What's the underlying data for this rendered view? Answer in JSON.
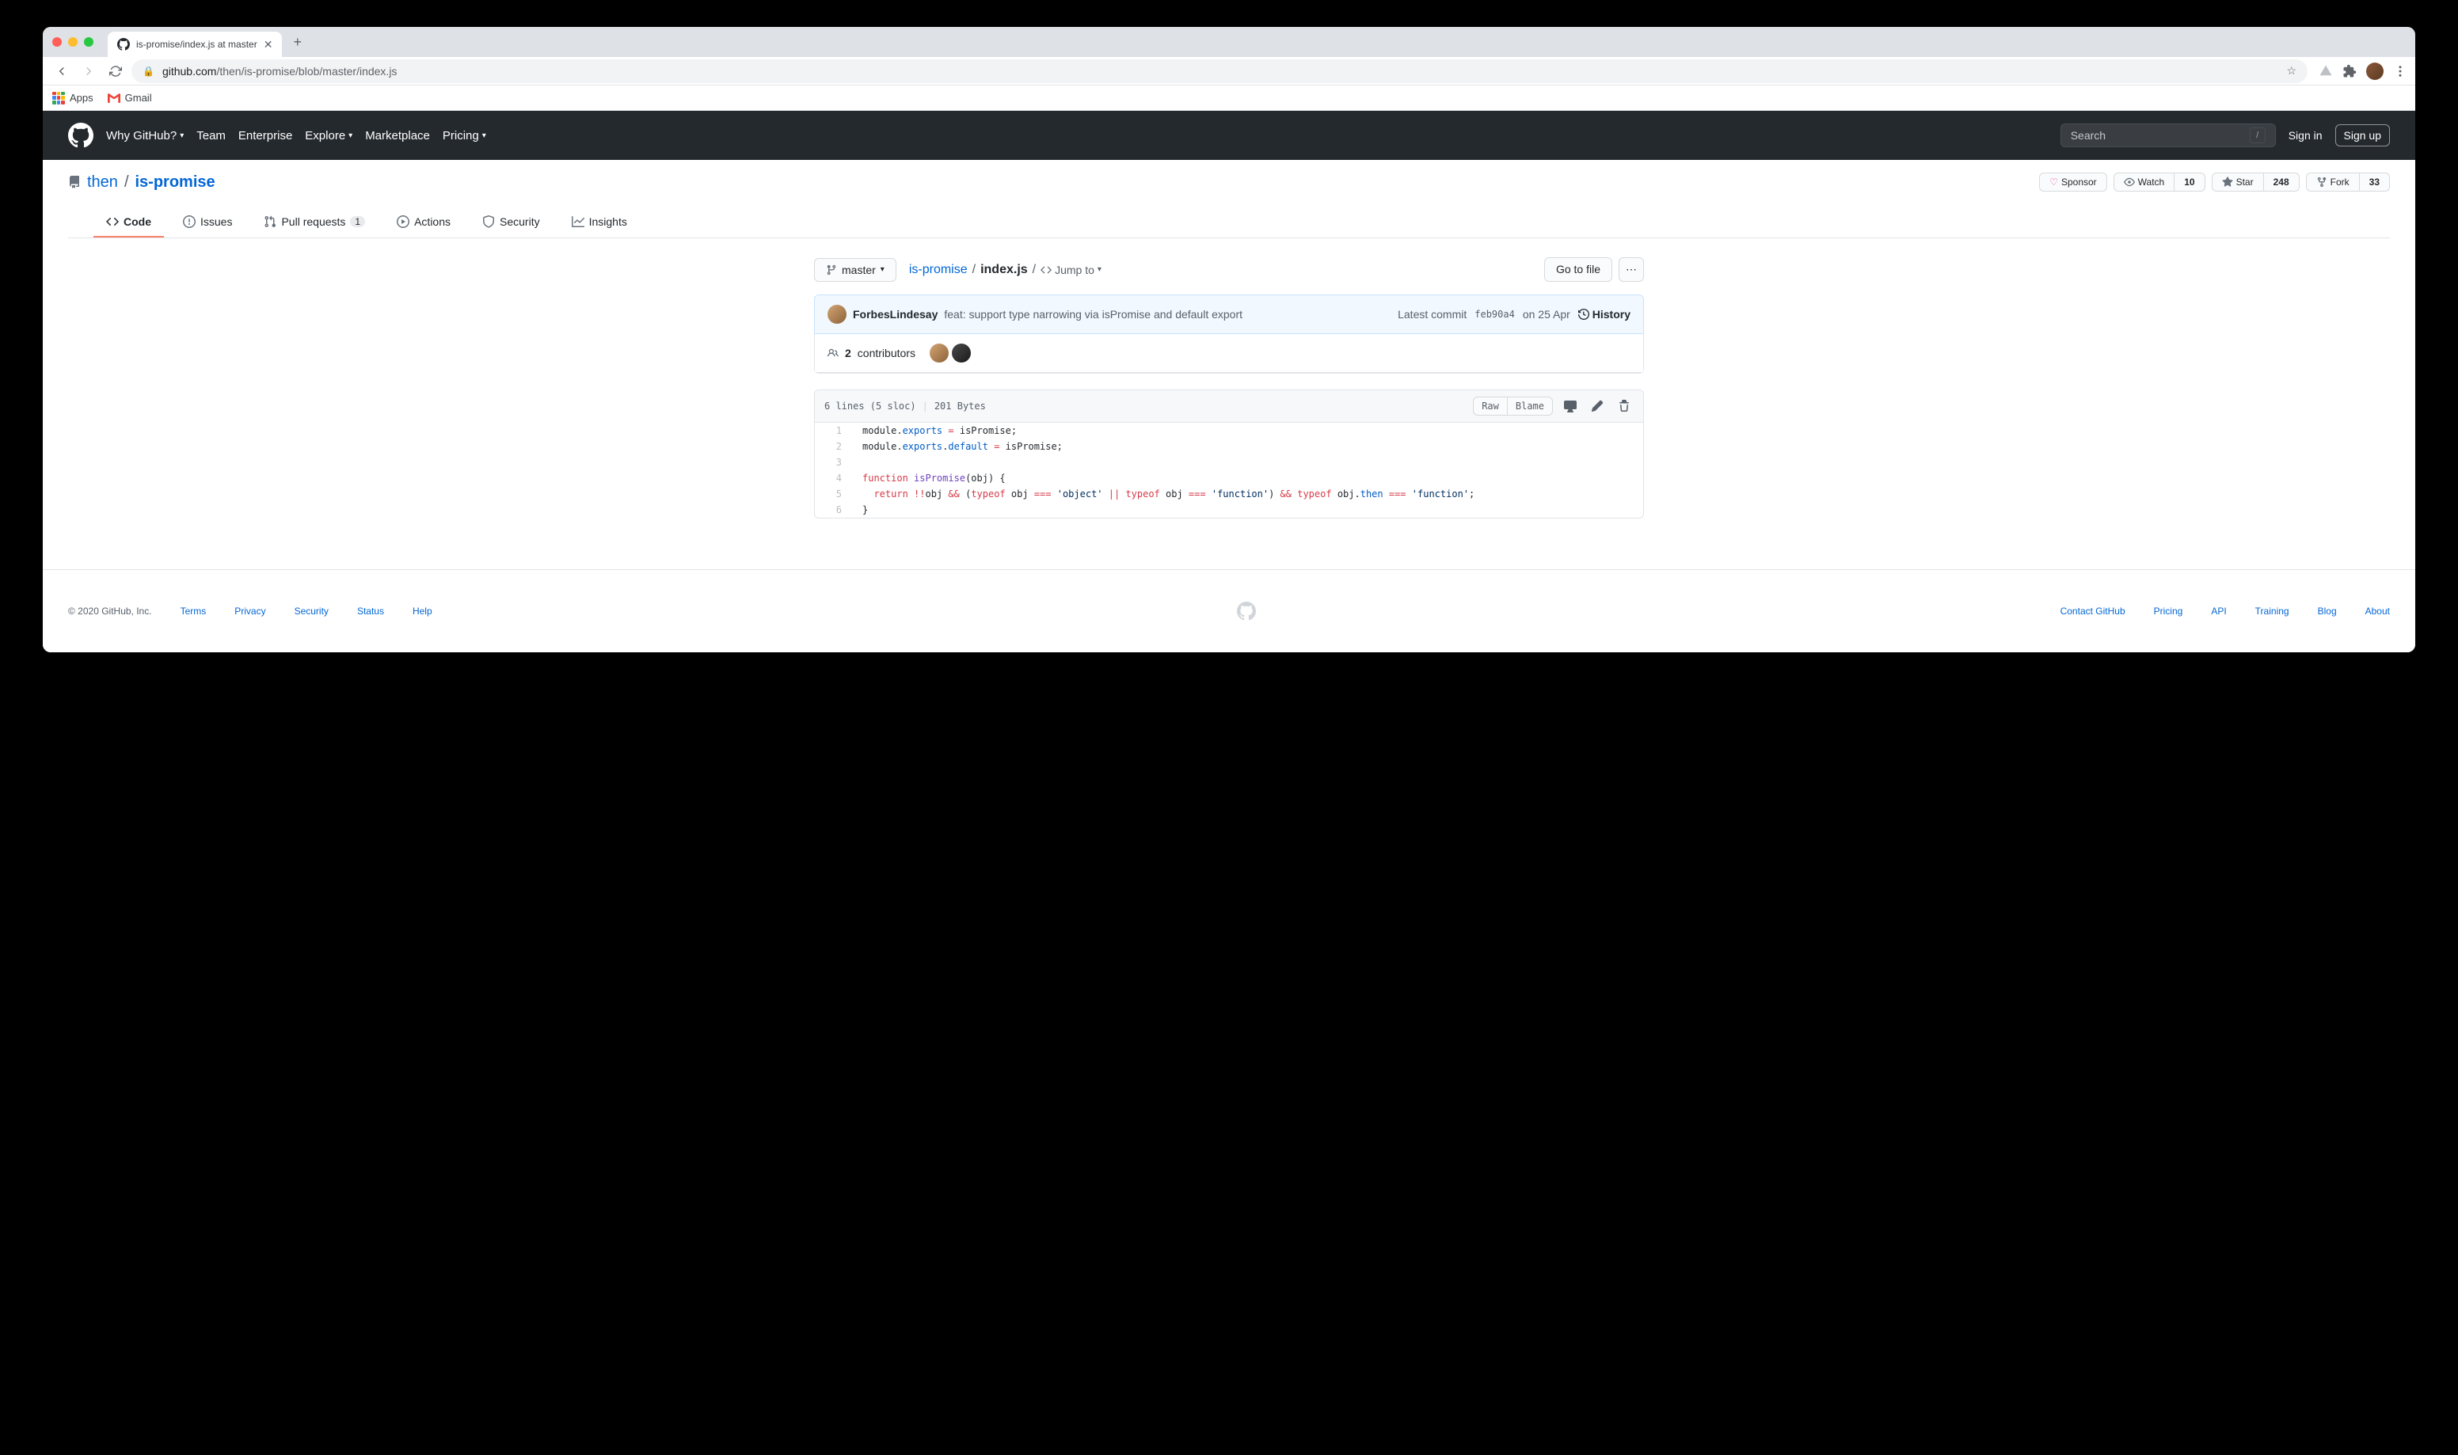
{
  "browser": {
    "tab_title": "is-promise/index.js at master",
    "url_host": "github.com",
    "url_path": "/then/is-promise/blob/master/index.js",
    "bookmarks": {
      "apps": "Apps",
      "gmail": "Gmail"
    }
  },
  "gh_header": {
    "nav": [
      "Why GitHub?",
      "Team",
      "Enterprise",
      "Explore",
      "Marketplace",
      "Pricing"
    ],
    "search_placeholder": "Search",
    "signin": "Sign in",
    "signup": "Sign up"
  },
  "repo": {
    "owner": "then",
    "name": "is-promise",
    "actions": {
      "sponsor": "Sponsor",
      "watch": "Watch",
      "watch_count": "10",
      "star": "Star",
      "star_count": "248",
      "fork": "Fork",
      "fork_count": "33"
    },
    "tabs": {
      "code": "Code",
      "issues": "Issues",
      "pulls": "Pull requests",
      "pulls_count": "1",
      "actions": "Actions",
      "security": "Security",
      "insights": "Insights"
    }
  },
  "file": {
    "branch": "master",
    "path_root": "is-promise",
    "path_file": "index.js",
    "jump_to": "Jump to",
    "go_to_file": "Go to file",
    "commit": {
      "author": "ForbesLindesay",
      "message": "feat: support type narrowing via isPromise and default export",
      "latest": "Latest commit",
      "sha": "feb90a4",
      "date": "on 25 Apr",
      "history": "History"
    },
    "contributors": {
      "count": "2",
      "label": "contributors"
    },
    "info": {
      "lines": "6 lines (5 sloc)",
      "size": "201 Bytes"
    },
    "actions": {
      "raw": "Raw",
      "blame": "Blame"
    },
    "code": [
      {
        "n": "1",
        "tokens": [
          {
            "t": "module.",
            "c": "def"
          },
          {
            "t": "exports",
            "c": "prop"
          },
          {
            "t": " ",
            "c": "def"
          },
          {
            "t": "=",
            "c": "op"
          },
          {
            "t": " isPromise;",
            "c": "def"
          }
        ]
      },
      {
        "n": "2",
        "tokens": [
          {
            "t": "module.",
            "c": "def"
          },
          {
            "t": "exports",
            "c": "prop"
          },
          {
            "t": ".",
            "c": "def"
          },
          {
            "t": "default",
            "c": "prop"
          },
          {
            "t": " ",
            "c": "def"
          },
          {
            "t": "=",
            "c": "op"
          },
          {
            "t": " isPromise;",
            "c": "def"
          }
        ]
      },
      {
        "n": "3",
        "tokens": []
      },
      {
        "n": "4",
        "tokens": [
          {
            "t": "function",
            "c": "kw"
          },
          {
            "t": " ",
            "c": "def"
          },
          {
            "t": "isPromise",
            "c": "fn"
          },
          {
            "t": "(",
            "c": "def"
          },
          {
            "t": "obj",
            "c": "def"
          },
          {
            "t": ") {",
            "c": "def"
          }
        ]
      },
      {
        "n": "5",
        "tokens": [
          {
            "t": "  ",
            "c": "def"
          },
          {
            "t": "return",
            "c": "kw"
          },
          {
            "t": " ",
            "c": "def"
          },
          {
            "t": "!!",
            "c": "op"
          },
          {
            "t": "obj ",
            "c": "def"
          },
          {
            "t": "&&",
            "c": "op"
          },
          {
            "t": " (",
            "c": "def"
          },
          {
            "t": "typeof",
            "c": "kw"
          },
          {
            "t": " obj ",
            "c": "def"
          },
          {
            "t": "===",
            "c": "op"
          },
          {
            "t": " ",
            "c": "def"
          },
          {
            "t": "'object'",
            "c": "str"
          },
          {
            "t": " ",
            "c": "def"
          },
          {
            "t": "||",
            "c": "op"
          },
          {
            "t": " ",
            "c": "def"
          },
          {
            "t": "typeof",
            "c": "kw"
          },
          {
            "t": " obj ",
            "c": "def"
          },
          {
            "t": "===",
            "c": "op"
          },
          {
            "t": " ",
            "c": "def"
          },
          {
            "t": "'function'",
            "c": "str"
          },
          {
            "t": ") ",
            "c": "def"
          },
          {
            "t": "&&",
            "c": "op"
          },
          {
            "t": " ",
            "c": "def"
          },
          {
            "t": "typeof",
            "c": "kw"
          },
          {
            "t": " obj.",
            "c": "def"
          },
          {
            "t": "then",
            "c": "prop"
          },
          {
            "t": " ",
            "c": "def"
          },
          {
            "t": "===",
            "c": "op"
          },
          {
            "t": " ",
            "c": "def"
          },
          {
            "t": "'function'",
            "c": "str"
          },
          {
            "t": ";",
            "c": "def"
          }
        ]
      },
      {
        "n": "6",
        "tokens": [
          {
            "t": "}",
            "c": "def"
          }
        ]
      }
    ]
  },
  "footer": {
    "copyright": "© 2020 GitHub, Inc.",
    "left": [
      "Terms",
      "Privacy",
      "Security",
      "Status",
      "Help"
    ],
    "right": [
      "Contact GitHub",
      "Pricing",
      "API",
      "Training",
      "Blog",
      "About"
    ]
  }
}
